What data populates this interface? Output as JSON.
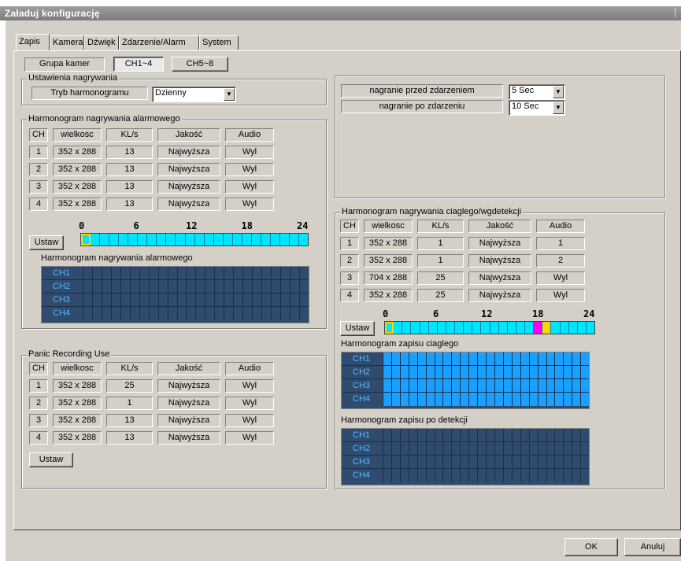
{
  "window": {
    "title": "Załaduj konfigurację"
  },
  "tabs": [
    "Zapis",
    "Kamera",
    "Dźwięk",
    "Zdarzenie/Alarm",
    "System"
  ],
  "camera_group": {
    "label": "Grupa kamer",
    "options": [
      "CH1~4",
      "CH5~8"
    ],
    "selected": "CH1~4"
  },
  "recording_settings": {
    "title": "Ustawienia nagrywania",
    "schedule_mode_label": "Tryb harmonogramu",
    "schedule_mode_value": "Dzienny"
  },
  "pre_post": {
    "pre_label": "nagranie przed zdarzeniem",
    "pre_value": "5 Sec",
    "post_label": "nagranie po zdarzeniu",
    "post_value": "10 Sec"
  },
  "table_headers": [
    "CH",
    "wielkosc",
    "KL/s",
    "Jakość",
    "Audio"
  ],
  "alarm": {
    "title": "Harmonogram nagrywania alarmowego",
    "rows": [
      [
        "1",
        "352 x 288",
        "13",
        "Najwyższa",
        "Wyl"
      ],
      [
        "2",
        "352 x 288",
        "13",
        "Najwyższa",
        "Wyl"
      ],
      [
        "3",
        "352 x 288",
        "13",
        "Najwyższa",
        "Wyl"
      ],
      [
        "4",
        "352 x 288",
        "13",
        "Najwyższa",
        "Wyl"
      ]
    ],
    "set_button": "Ustaw",
    "grid_caption": "Harmonogram nagrywania alarmowego"
  },
  "timeline_labels": [
    "0",
    "6",
    "12",
    "18",
    "24"
  ],
  "channels": [
    "CH1",
    "CH2",
    "CH3",
    "CH4"
  ],
  "continuous": {
    "title": "Harmonogram nagrywania ciaglego/wgdetekcji",
    "rows": [
      [
        "1",
        "352 x 288",
        "1",
        "Najwyższa",
        "1"
      ],
      [
        "2",
        "352 x 288",
        "1",
        "Najwyższa",
        "2"
      ],
      [
        "3",
        "704 x 288",
        "25",
        "Najwyższa",
        "Wyl"
      ],
      [
        "4",
        "352 x 288",
        "25",
        "Najwyższa",
        "Wyl"
      ]
    ],
    "set_button": "Ustaw",
    "continuous_caption": "Harmonogram zapisu ciaglego",
    "detection_caption": "Harmonogram zapisu po detekcji",
    "bar_markers": {
      "magenta_hour": 17,
      "yellow_hour": 18
    }
  },
  "panic": {
    "title": "Panic Recording Use",
    "rows": [
      [
        "1",
        "352 x 288",
        "25",
        "Najwyższa",
        "Wyl"
      ],
      [
        "2",
        "352 x 288",
        "1",
        "Najwyższa",
        "Wyl"
      ],
      [
        "3",
        "352 x 288",
        "13",
        "Najwyższa",
        "Wyl"
      ],
      [
        "4",
        "352 x 288",
        "13",
        "Najwyższa",
        "Wyl"
      ]
    ],
    "set_button": "Ustaw"
  },
  "footer": {
    "ok": "OK",
    "cancel": "Anuluj"
  },
  "colors": {
    "timeline_fill": "#00e5ff",
    "grid_dark": "#2f4b6e",
    "grid_active": "#1ba0ff",
    "magenta": "#ff00ff",
    "yellow": "#ffd400"
  }
}
